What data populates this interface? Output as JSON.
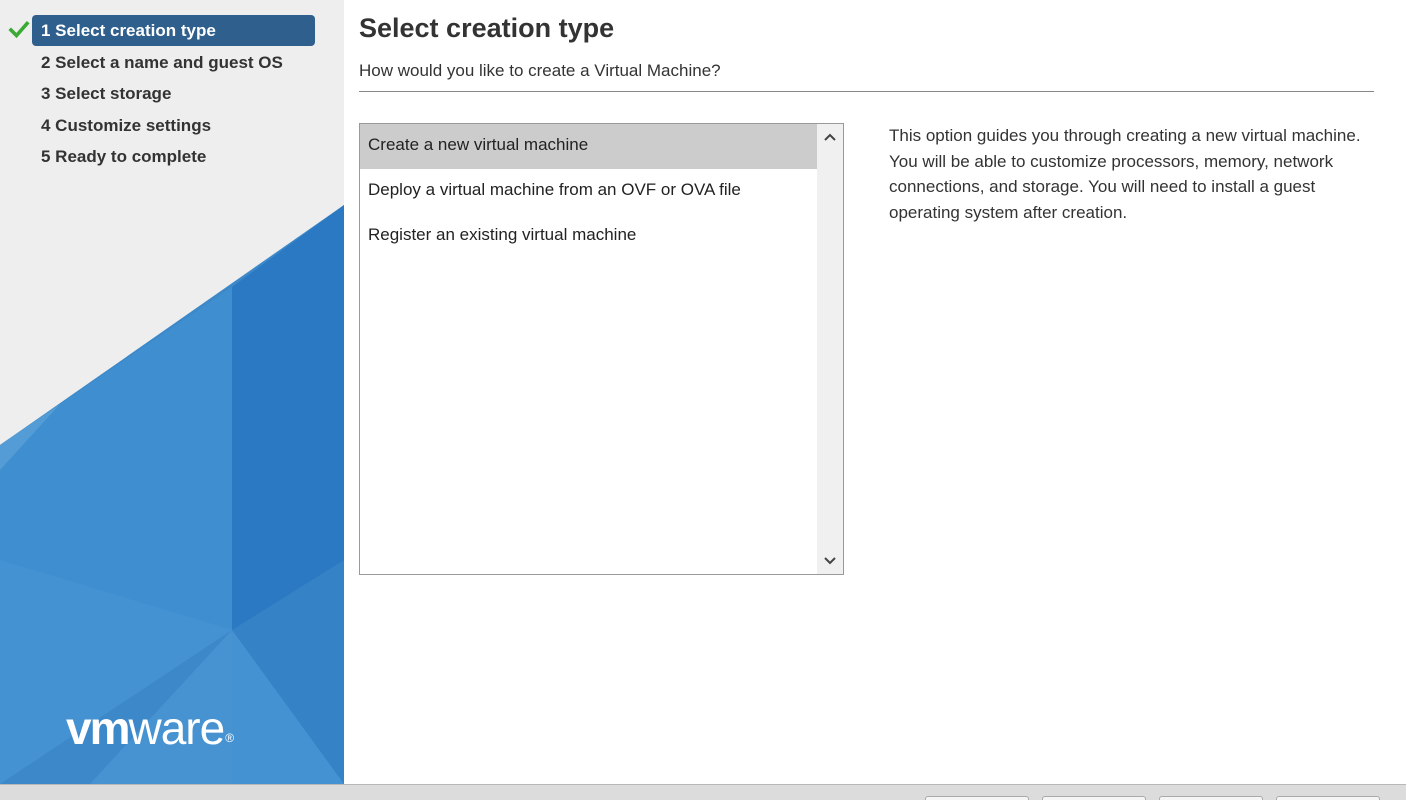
{
  "colors": {
    "sidebar_bg": "#eeeeee",
    "active_step_bg": "#2f5f8c",
    "check_green": "#3aaa35",
    "selected_item_bg": "#cccccc",
    "brand_blue": "#2b7bc8"
  },
  "sidebar": {
    "steps": [
      {
        "label": "1 Select creation type",
        "state": "active",
        "icon": "check-icon"
      },
      {
        "label": "2 Select a name and guest OS",
        "state": "pending"
      },
      {
        "label": "3 Select storage",
        "state": "pending"
      },
      {
        "label": "4 Customize settings",
        "state": "pending"
      },
      {
        "label": "5 Ready to complete",
        "state": "pending"
      }
    ],
    "logo": {
      "vm": "vm",
      "ware": "ware",
      "reg": "®"
    }
  },
  "main": {
    "title": "Select creation type",
    "subtitle": "How would you like to create a Virtual Machine?",
    "options": [
      {
        "label": "Create a new virtual machine",
        "selected": true
      },
      {
        "label": "Deploy a virtual machine from an OVF or OVA file",
        "selected": false
      },
      {
        "label": "Register an existing virtual machine",
        "selected": false
      }
    ],
    "description": "This option guides you through creating a new virtual machine. You will be able to customize processors, memory, network connections, and storage. You will need to install a guest operating system after creation."
  },
  "footer": {
    "buttons": [
      "",
      "",
      "",
      ""
    ]
  }
}
